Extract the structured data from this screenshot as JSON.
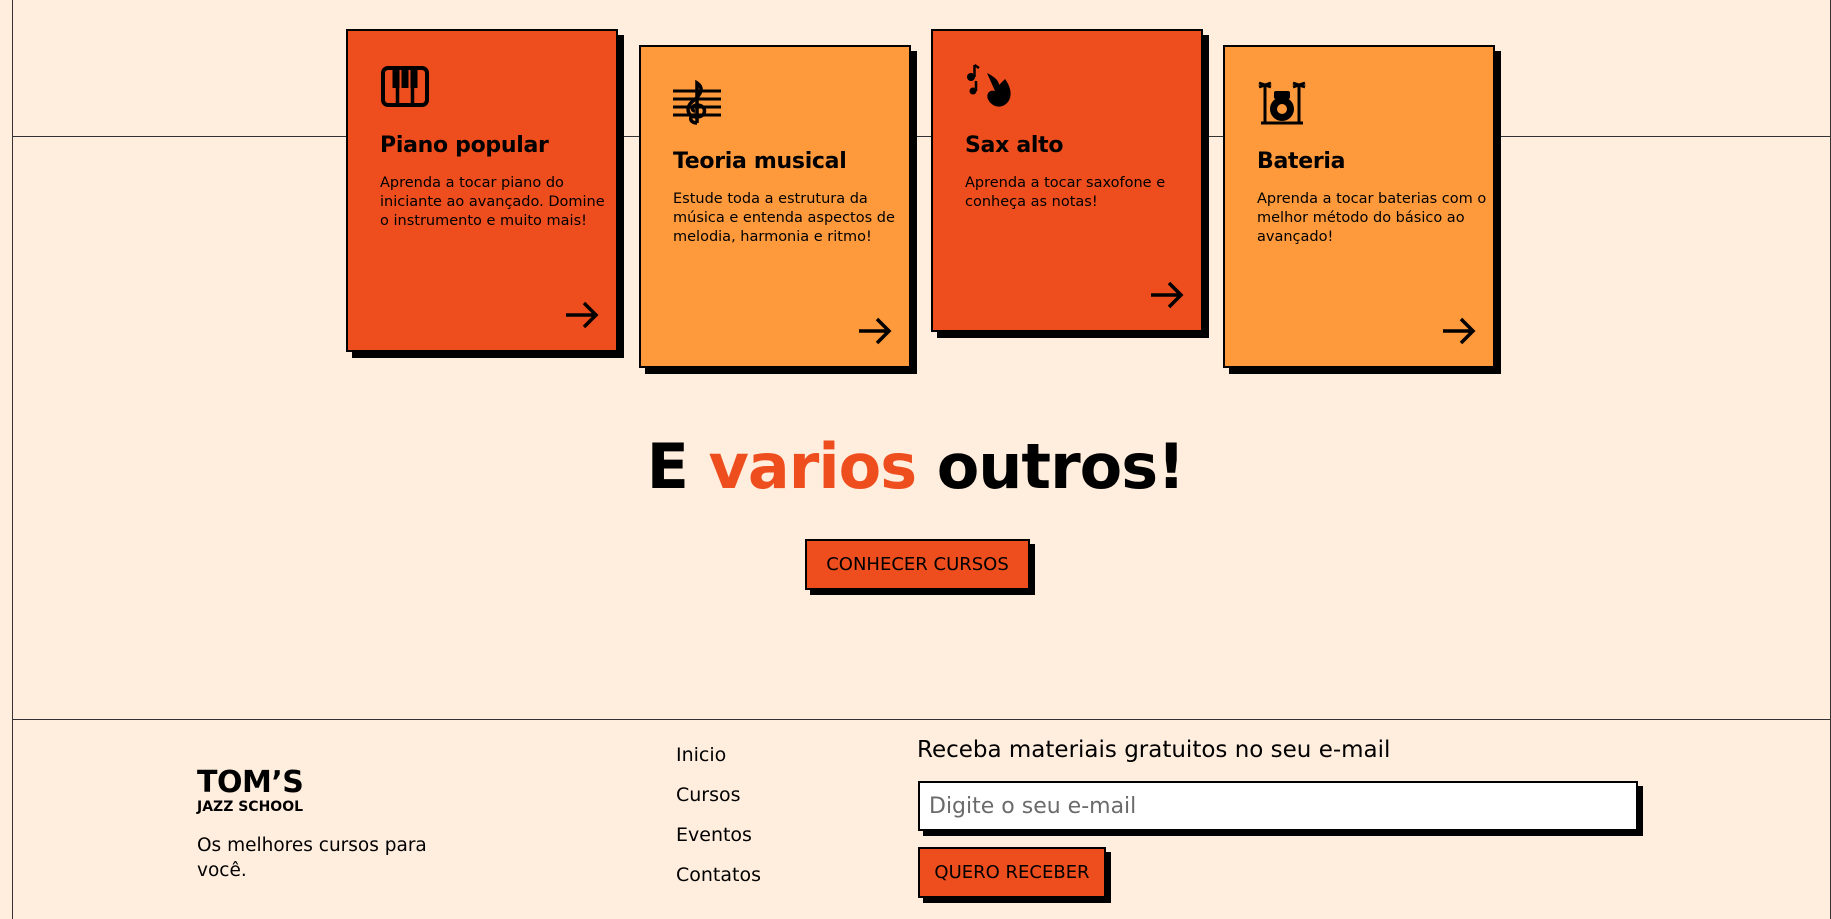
{
  "courses": [
    {
      "title": "Piano popular",
      "description": "Aprenda a tocar piano do iniciante ao avançado. Domine o instrumento e muito mais!",
      "icon": "piano-icon",
      "color": "#ee4e1e"
    },
    {
      "title": "Teoria musical",
      "description": "Estude toda a estrutura da música e entenda aspectos de melodia, harmonia e ritmo!",
      "icon": "treble-clef-icon",
      "color": "#ff9a3c"
    },
    {
      "title": "Sax alto",
      "description": "Aprenda a tocar saxofone e conheça as notas!",
      "icon": "saxophone-icon",
      "color": "#ee4e1e"
    },
    {
      "title": "Bateria",
      "description": "Aprenda a tocar baterias com o melhor método do básico ao avançado!",
      "icon": "drum-kit-icon",
      "color": "#ff9a3c"
    }
  ],
  "headline": {
    "part1": "E ",
    "accent": "varios",
    "part2": " outros!"
  },
  "cta": {
    "label": "CONHECER CURSOS"
  },
  "footer": {
    "logo_main": "TOM’S",
    "logo_sub": "JAZZ SCHOOL",
    "tagline": "Os melhores cursos para você.",
    "nav": [
      "Inicio",
      "Cursos",
      "Eventos",
      "Contatos"
    ],
    "newsletter": {
      "title": "Receba materiais gratuitos no seu e-mail",
      "placeholder": "Digite o seu e-mail",
      "button": "QUERO RECEBER"
    }
  },
  "colors": {
    "background": "#ffeddd",
    "accent": "#ee4e1e",
    "orange": "#ff9a3c"
  }
}
